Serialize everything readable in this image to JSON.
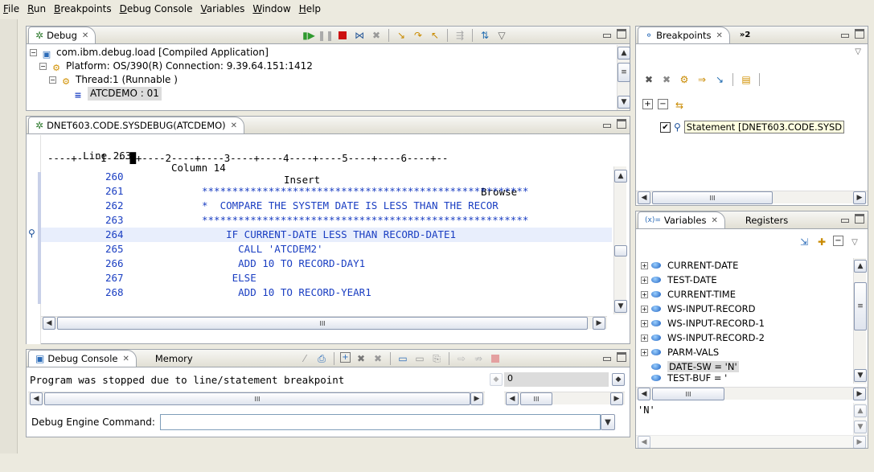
{
  "menu": [
    "File",
    "Run",
    "Breakpoints",
    "Debug Console",
    "Variables",
    "Window",
    "Help"
  ],
  "debug_view": {
    "tab": "Debug",
    "tree": [
      {
        "label": "com.ibm.debug.load [Compiled Application]"
      },
      {
        "label": "Platform: OS/390(R)   Connection: 9.39.64.151:1412"
      },
      {
        "label": "Thread:1 (Runnable )"
      },
      {
        "label": "ATCDEMO : 01"
      }
    ]
  },
  "breakpoints_view": {
    "tab": "Breakpoints",
    "overflow": "»2",
    "item": "Statement [DNET603.CODE.SYSD"
  },
  "editor": {
    "tab": "DNET603.CODE.SYSDEBUG(ATCDEMO)",
    "status": {
      "line": "Line 263",
      "column": "Column 14",
      "mode": "Insert",
      "state": "Browse"
    },
    "ruler": "----+----1----█+----2----+----3----+----4----+----5----+----6----+--",
    "lines": [
      {
        "num": "260",
        "text": ""
      },
      {
        "num": "261",
        "text": "******************************************************"
      },
      {
        "num": "262",
        "text": "*  COMPARE THE SYSTEM DATE IS LESS THAN THE RECOR"
      },
      {
        "num": "263",
        "text": "******************************************************"
      },
      {
        "num": "264",
        "text": "    IF CURRENT-DATE LESS THAN RECORD-DATE1"
      },
      {
        "num": "265",
        "text": "      CALL 'ATCDEM2'"
      },
      {
        "num": "266",
        "text": "      ADD 10 TO RECORD-DAY1"
      },
      {
        "num": "267",
        "text": "     ELSE"
      },
      {
        "num": "268",
        "text": "      ADD 10 TO RECORD-YEAR1"
      }
    ]
  },
  "variables_view": {
    "tabs": [
      "Variables",
      "Registers"
    ],
    "tab_prefix": "(x)=",
    "items": [
      "CURRENT-DATE",
      "TEST-DATE",
      "CURRENT-TIME",
      "WS-INPUT-RECORD",
      "WS-INPUT-RECORD-1",
      "WS-INPUT-RECORD-2",
      "PARM-VALS",
      "DATE-SW = 'N'",
      "TEST-BUF = '"
    ],
    "detail": "'N'"
  },
  "console_view": {
    "tabs": [
      "Debug Console",
      "Memory"
    ],
    "message": "Program was stopped due to line/statement breakpoint",
    "side_value": "0",
    "command_label": "Debug Engine Command:",
    "command_value": ""
  },
  "icons": {
    "debug": "bug-icon",
    "resume": "resume-icon",
    "suspend": "suspend-icon",
    "terminate": "terminate-icon",
    "step_into": "step-into-icon",
    "step_over": "step-over-icon",
    "step_return": "step-return-icon",
    "breakpoint_marker": "breakpoint-marker-icon"
  },
  "colors": {
    "code": "#1a3ec2",
    "current_line": "#e8eefc",
    "terminate": "#cc1010",
    "resume": "#2f9a2f"
  }
}
